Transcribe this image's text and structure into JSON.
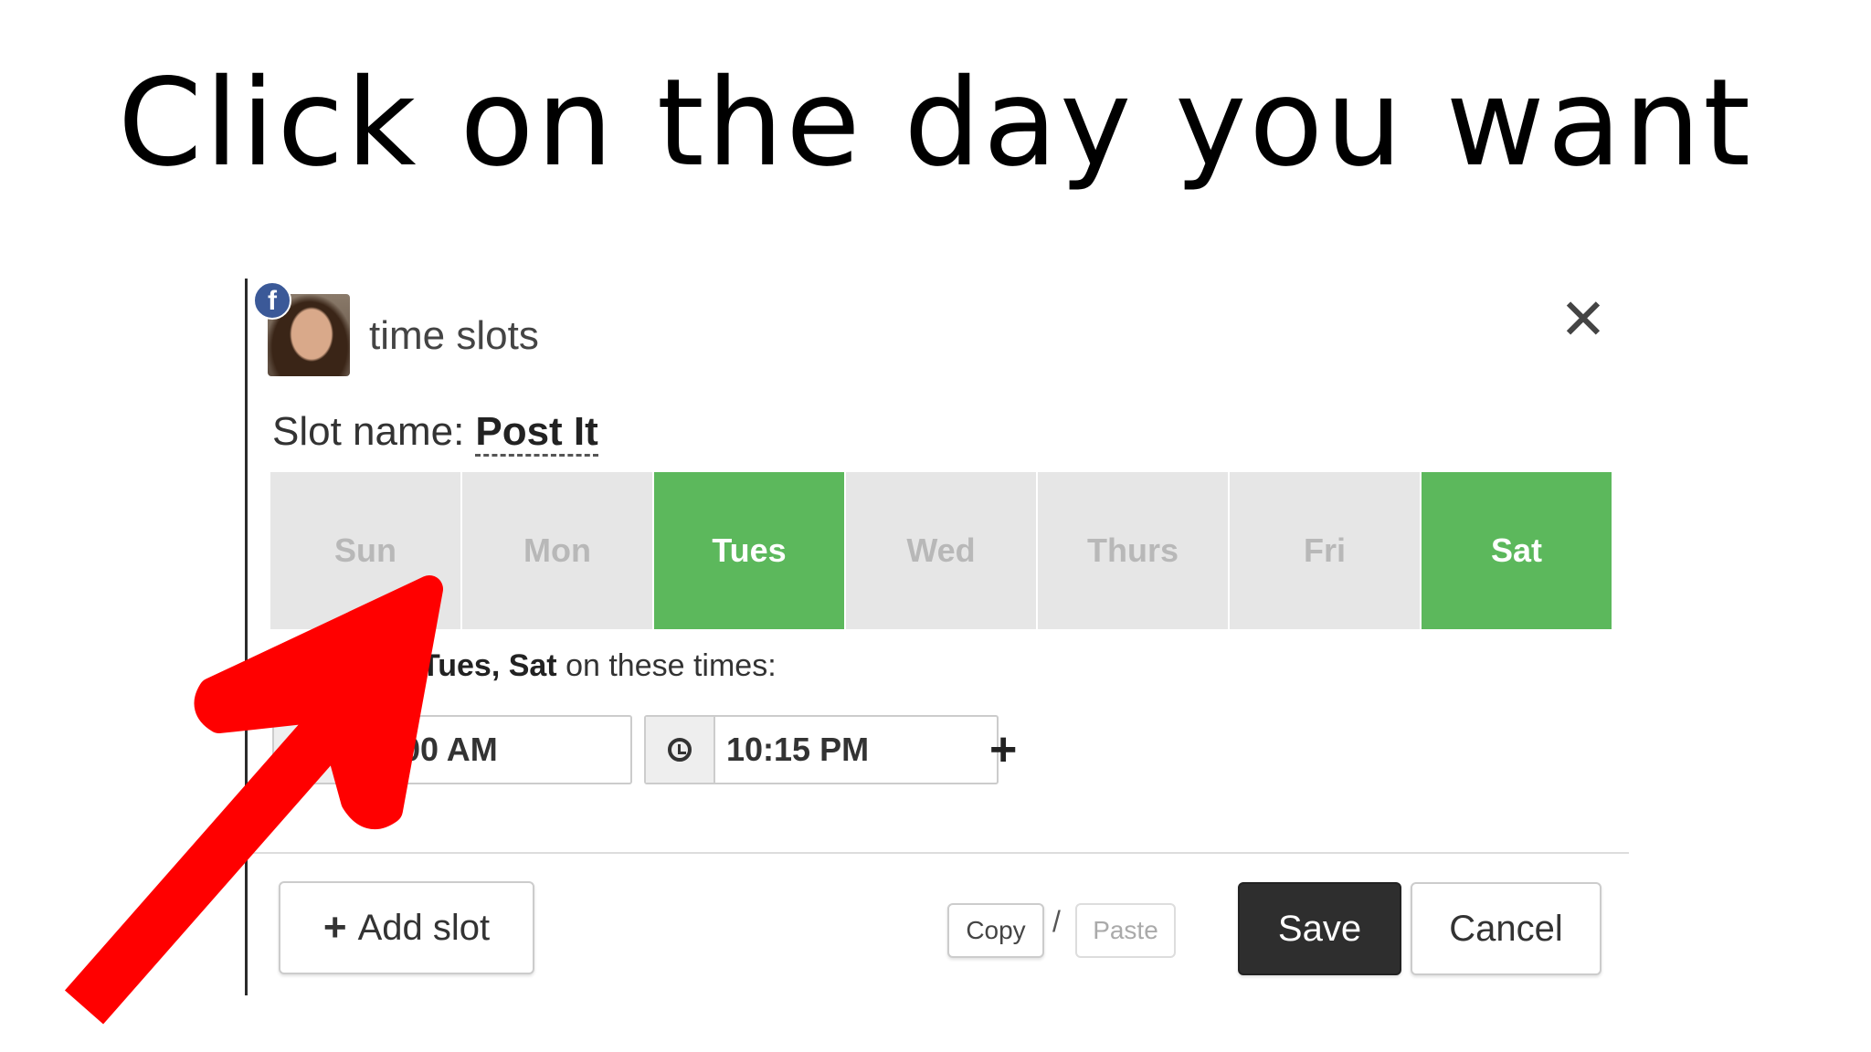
{
  "headline": "Click on the day you want",
  "dialog": {
    "badge_icon": "facebook-icon",
    "title": "time slots",
    "close_icon": "close-icon",
    "slot_name_label": "Slot name:",
    "slot_name_value": "Post It"
  },
  "days": [
    {
      "label": "Sun",
      "selected": false
    },
    {
      "label": "Mon",
      "selected": false
    },
    {
      "label": "Tues",
      "selected": true
    },
    {
      "label": "Wed",
      "selected": false
    },
    {
      "label": "Thurs",
      "selected": false
    },
    {
      "label": "Fri",
      "selected": false
    },
    {
      "label": "Sat",
      "selected": true
    }
  ],
  "repeat_text": {
    "days_bold": "Tues, Sat",
    "suffix": "on these times:"
  },
  "times": {
    "first": "10:00 AM",
    "second": "10:15 PM",
    "add_icon": "plus-icon"
  },
  "footer": {
    "add_slot_label": "Add slot",
    "copy_label": "Copy",
    "separator": "/",
    "paste_label": "Paste",
    "save_label": "Save",
    "cancel_label": "Cancel"
  },
  "colors": {
    "selected_day": "#5cb85c",
    "unselected_day": "#e6e6e6",
    "arrow": "#ff0000",
    "save_button": "#2e2e2e"
  }
}
